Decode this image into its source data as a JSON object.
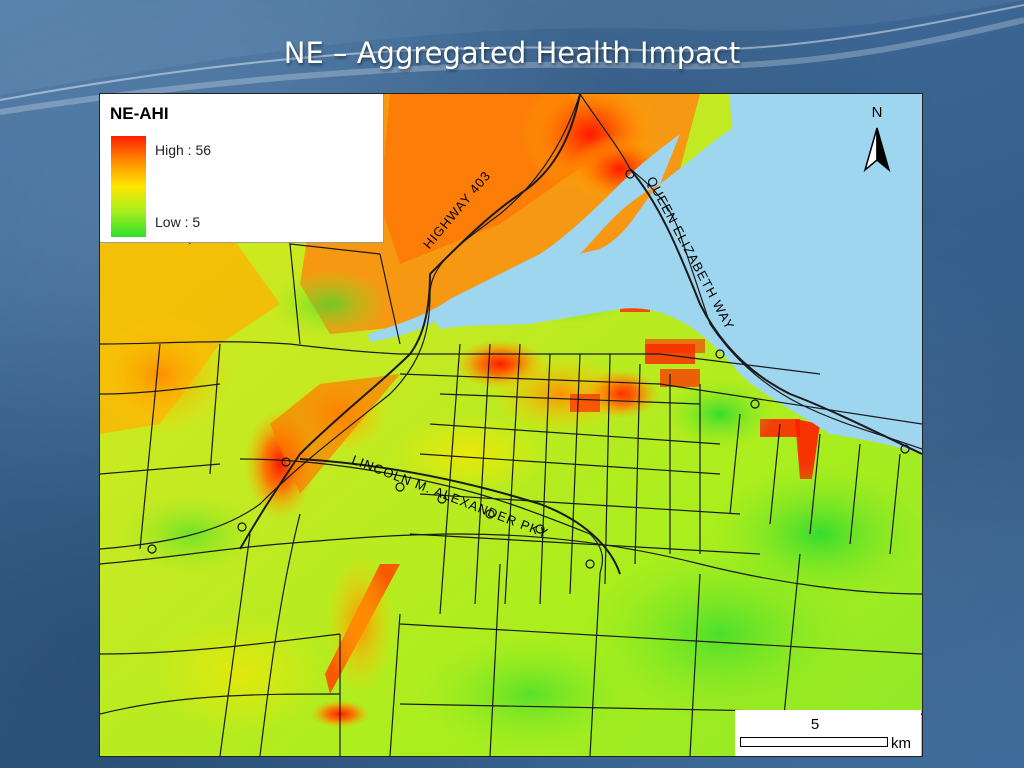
{
  "slide": {
    "title": "NE – Aggregated Health Impact"
  },
  "legend": {
    "title": "NE-AHI",
    "high_label": "High : 56",
    "low_label": "Low : 5",
    "high_color": "#ff1e00",
    "mid_color": "#ffe600",
    "low_color": "#2ee02e"
  },
  "map": {
    "north_label": "N",
    "scale_value": "5",
    "scale_unit": "km",
    "water_color": "#9dd6ee",
    "road_labels": [
      {
        "text": "HIGHWAY 403"
      },
      {
        "text": "QUEEN ELIZABETH WAY"
      },
      {
        "text": "LINCOLN M. ALEXANDER PKY"
      }
    ]
  }
}
